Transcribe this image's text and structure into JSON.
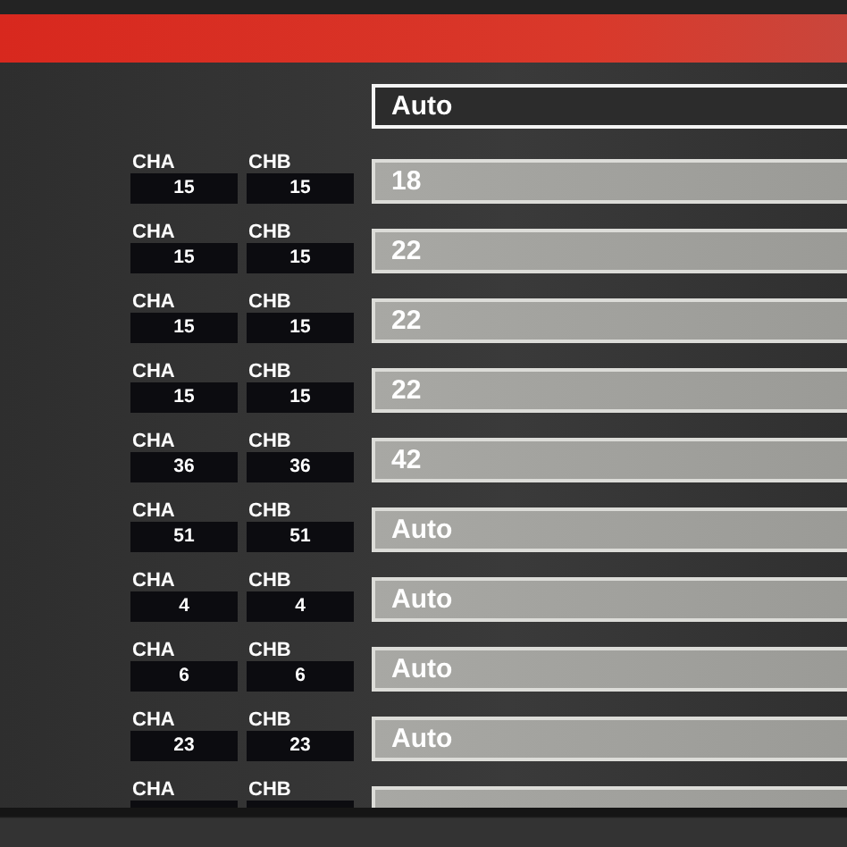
{
  "top_field": {
    "value": "Auto",
    "selected": true
  },
  "rows": [
    {
      "cha_label": "CHA",
      "cha_value": "15",
      "chb_label": "CHB",
      "chb_value": "15",
      "field": {
        "value": "18",
        "selected": false
      }
    },
    {
      "cha_label": "CHA",
      "cha_value": "15",
      "chb_label": "CHB",
      "chb_value": "15",
      "field": {
        "value": "22",
        "selected": false
      }
    },
    {
      "cha_label": "CHA",
      "cha_value": "15",
      "chb_label": "CHB",
      "chb_value": "15",
      "field": {
        "value": "22",
        "selected": false
      }
    },
    {
      "cha_label": "CHA",
      "cha_value": "15",
      "chb_label": "CHB",
      "chb_value": "15",
      "field": {
        "value": "22",
        "selected": false
      }
    },
    {
      "cha_label": "CHA",
      "cha_value": "36",
      "chb_label": "CHB",
      "chb_value": "36",
      "field": {
        "value": "42",
        "selected": false
      }
    },
    {
      "cha_label": "CHA",
      "cha_value": "51",
      "chb_label": "CHB",
      "chb_value": "51",
      "field": {
        "value": "Auto",
        "selected": false
      }
    },
    {
      "cha_label": "CHA",
      "cha_value": "4",
      "chb_label": "CHB",
      "chb_value": "4",
      "field": {
        "value": "Auto",
        "selected": false
      }
    },
    {
      "cha_label": "CHA",
      "cha_value": "6",
      "chb_label": "CHB",
      "chb_value": "6",
      "field": {
        "value": "Auto",
        "selected": false
      }
    },
    {
      "cha_label": "CHA",
      "cha_value": "23",
      "chb_label": "CHB",
      "chb_value": "23",
      "field": {
        "value": "Auto",
        "selected": false
      }
    },
    {
      "cha_label": "CHA",
      "chb_label": "CHB",
      "field": {
        "selected": false
      }
    }
  ]
}
